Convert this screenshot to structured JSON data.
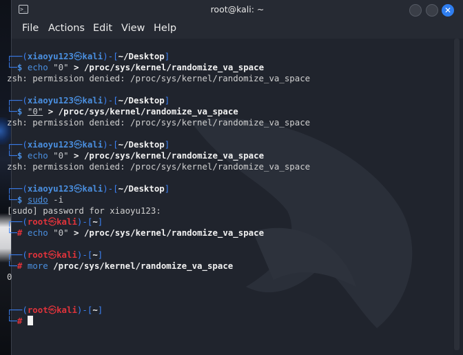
{
  "window": {
    "title": "root@kali: ~",
    "terminal_icon_glyph": ">_",
    "close_glyph": "✕",
    "accent": "#2f7ef0"
  },
  "menu": {
    "items": [
      "File",
      "Actions",
      "Edit",
      "View",
      "Help"
    ]
  },
  "terminal": {
    "blocks": [
      {
        "user": "xiaoyu123",
        "host": "kali",
        "cwd": "~/Desktop",
        "root": false,
        "prompt_char": "$",
        "cmd": "echo",
        "args": "\"0\"",
        "op": ">",
        "target": "/proc/sys/kernel/randomize_va_space",
        "output": [
          "zsh: permission denied: /proc/sys/kernel/randomize_va_space"
        ]
      },
      {
        "user": "xiaoyu123",
        "host": "kali",
        "cwd": "~/Desktop",
        "root": false,
        "prompt_char": "$",
        "cmd": "",
        "args": "\"0\"",
        "op": ">",
        "target": "/proc/sys/kernel/randomize_va_space",
        "output": [
          "zsh: permission denied: /proc/sys/kernel/randomize_va_space"
        ]
      },
      {
        "user": "xiaoyu123",
        "host": "kali",
        "cwd": "~/Desktop",
        "root": false,
        "prompt_char": "$",
        "cmd": "echo",
        "args": "\"0\"",
        "op": ">",
        "target": "/proc/sys/kernel/randomize_va_space",
        "output": [
          "zsh: permission denied: /proc/sys/kernel/randomize_va_space"
        ]
      },
      {
        "user": "xiaoyu123",
        "host": "kali",
        "cwd": "~/Desktop",
        "root": false,
        "prompt_char": "$",
        "cmd": "sudo",
        "args": "-i",
        "op": "",
        "target": "",
        "output": [
          "[sudo] password for xiaoyu123:"
        ]
      },
      {
        "user": "root",
        "host": "kali",
        "cwd": "~",
        "root": true,
        "prompt_char": "#",
        "cmd": "echo",
        "args": "\"0\"",
        "op": ">",
        "target": "/proc/sys/kernel/randomize_va_space",
        "output": []
      },
      {
        "user": "root",
        "host": "kali",
        "cwd": "~",
        "root": true,
        "prompt_char": "#",
        "cmd": "more",
        "args": "",
        "op": "",
        "target": "/proc/sys/kernel/randomize_va_space",
        "output": [
          "0"
        ]
      },
      {
        "user": "root",
        "host": "kali",
        "cwd": "~",
        "root": true,
        "prompt_char": "#",
        "cmd": "",
        "args": "",
        "op": "",
        "target": "",
        "output": [],
        "cursor": true
      }
    ]
  }
}
